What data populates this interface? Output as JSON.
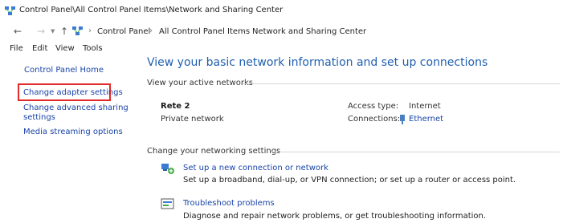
{
  "window": {
    "title": "Control Panel\\All Control Panel Items\\Network and Sharing Center"
  },
  "address": {
    "breadcrumbs": [
      "Control Panel",
      "All Control Panel Items",
      "Network and Sharing Center"
    ]
  },
  "menu": [
    "File",
    "Edit",
    "View",
    "Tools"
  ],
  "sidebar": {
    "home": "Control Panel Home",
    "change_adapter": "Change adapter settings",
    "change_sharing_line1": "Change advanced sharing",
    "change_sharing_line2": "settings",
    "media_streaming": "Media streaming options"
  },
  "main": {
    "title": "View your basic network information and set up connections",
    "active_heading": "View your active networks",
    "network": {
      "name": "Rete 2",
      "type": "Private network",
      "access_type_label": "Access type:",
      "access_type_value": "Internet",
      "connections_label": "Connections:",
      "connections_value": "Ethernet"
    },
    "change_heading": "Change your networking settings",
    "tasks": [
      {
        "link": "Set up a new connection or network",
        "desc": "Set up a broadband, dial-up, or VPN connection; or set up a router or access point."
      },
      {
        "link": "Troubleshoot problems",
        "desc": "Diagnose and repair network problems, or get troubleshooting information."
      }
    ]
  },
  "colors": {
    "link": "#1a44a8",
    "title": "#1f5fb0",
    "highlight": "#e32a2a"
  },
  "icons": {
    "window": "network-center-icon",
    "back": "arrow-left-icon",
    "forward": "arrow-right-icon",
    "up": "arrow-up-icon",
    "ethernet": "ethernet-icon",
    "new_connection": "network-setup-icon",
    "troubleshoot": "troubleshoot-icon"
  }
}
